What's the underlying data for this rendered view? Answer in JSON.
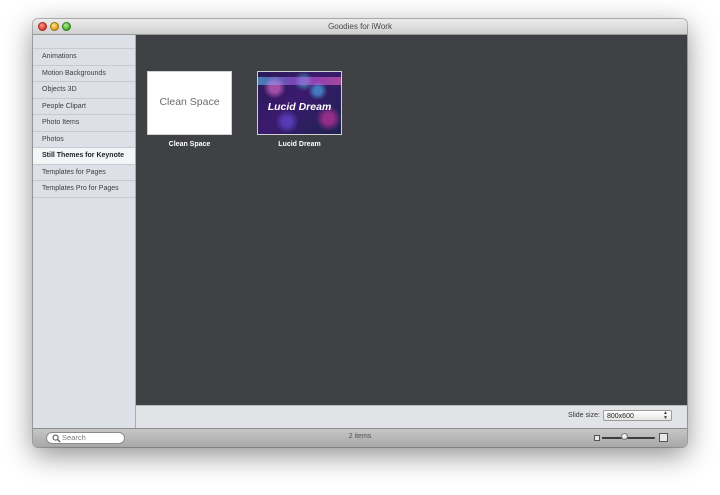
{
  "window": {
    "title": "Goodies for iWork"
  },
  "sidebar": {
    "items": [
      {
        "label": "Animations"
      },
      {
        "label": "Motion Backgrounds"
      },
      {
        "label": "Objects 3D"
      },
      {
        "label": "People Clipart"
      },
      {
        "label": "Photo Items"
      },
      {
        "label": "Photos"
      },
      {
        "label": "Still Themes for Keynote",
        "selected": true
      },
      {
        "label": "Templates for Pages"
      },
      {
        "label": "Templates Pro for Pages"
      }
    ]
  },
  "content": {
    "themes": [
      {
        "name": "Clean Space",
        "preview_text": "Clean Space"
      },
      {
        "name": "Lucid Dream",
        "preview_text": "Lucid Dream"
      }
    ]
  },
  "bottom": {
    "slide_size_label": "Slide size:",
    "slide_size_value": "800x600"
  },
  "statusbar": {
    "search_placeholder": "Search",
    "item_count": "2 items",
    "zoom_level": 0.42
  }
}
